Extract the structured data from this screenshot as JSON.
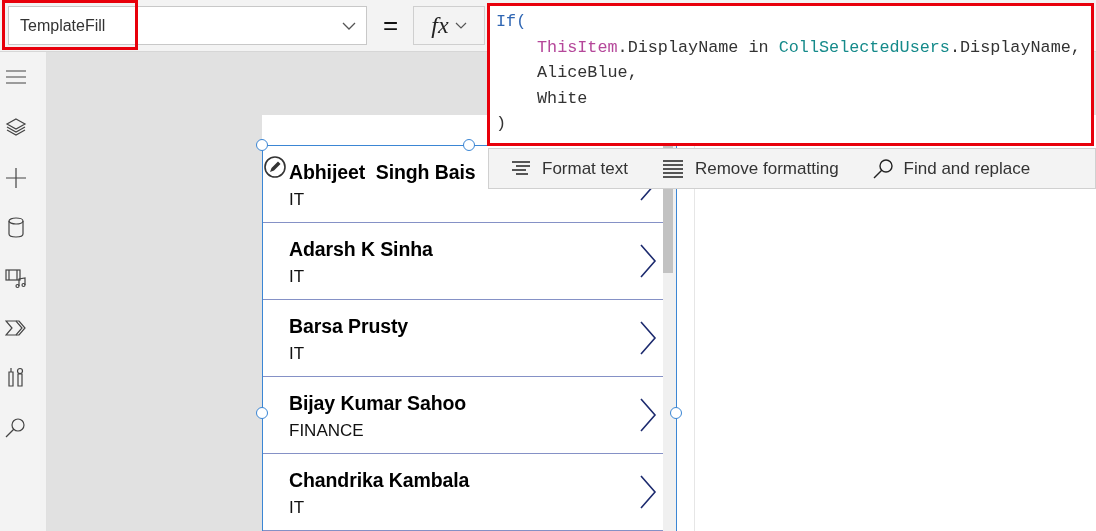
{
  "property_selector": {
    "value": "TemplateFill",
    "highlighted": true
  },
  "equals_sign": "=",
  "fx_button": {
    "label": "fx"
  },
  "formula": {
    "highlighted": true,
    "lines": [
      {
        "indent": false,
        "tokens": [
          {
            "text": "If(",
            "kind": "keyword"
          }
        ]
      },
      {
        "indent": true,
        "tokens": [
          {
            "text": "ThisItem",
            "kind": "object"
          },
          {
            "text": ".DisplayName in ",
            "kind": "plain"
          },
          {
            "text": "CollSelectedUsers",
            "kind": "collection"
          },
          {
            "text": ".DisplayName,",
            "kind": "plain"
          }
        ]
      },
      {
        "indent": true,
        "tokens": [
          {
            "text": "AliceBlue,",
            "kind": "plain"
          }
        ]
      },
      {
        "indent": true,
        "tokens": [
          {
            "text": "White",
            "kind": "plain"
          }
        ]
      },
      {
        "indent": false,
        "tokens": [
          {
            "text": ")",
            "kind": "plain"
          }
        ]
      }
    ]
  },
  "format_toolbar": {
    "items": [
      {
        "label": "Format text",
        "kind": "format"
      },
      {
        "label": "Remove formatting",
        "kind": "remove"
      },
      {
        "label": "Find and replace",
        "kind": "find"
      }
    ]
  },
  "rail_icons": [
    {
      "kind": "menu"
    },
    {
      "kind": "layers"
    },
    {
      "kind": "insert"
    },
    {
      "kind": "data"
    },
    {
      "kind": "media"
    },
    {
      "kind": "automate"
    },
    {
      "kind": "tools"
    },
    {
      "kind": "search"
    }
  ],
  "gallery": {
    "selected": true,
    "rows": [
      {
        "name": "Abhijeet  Singh Bais",
        "department": "IT"
      },
      {
        "name": "Adarsh K Sinha",
        "department": "IT"
      },
      {
        "name": "Barsa Prusty",
        "department": "IT"
      },
      {
        "name": "Bijay Kumar Sahoo",
        "department": "FINANCE"
      },
      {
        "name": "Chandrika Kambala",
        "department": "IT"
      }
    ]
  }
}
